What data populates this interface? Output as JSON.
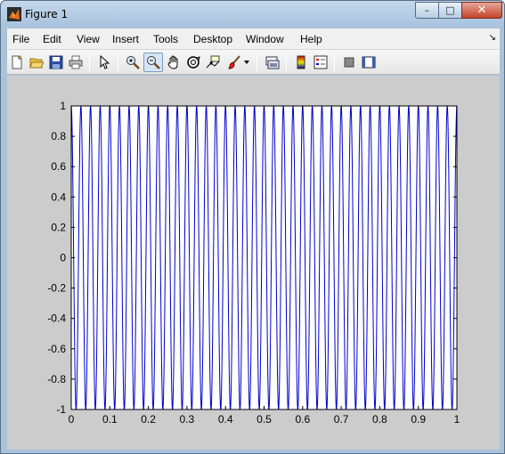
{
  "window": {
    "title": "Figure 1",
    "minimize_symbol": "–",
    "maximize_symbol": "□",
    "close_symbol": "✕"
  },
  "menubar": {
    "items": [
      "File",
      "Edit",
      "View",
      "Insert",
      "Tools",
      "Desktop",
      "Window",
      "Help"
    ],
    "overflow_symbol": "↘"
  },
  "toolbar": {
    "buttons": [
      {
        "name": "new-figure-icon"
      },
      {
        "name": "open-file-icon"
      },
      {
        "name": "save-icon"
      },
      {
        "name": "print-icon"
      },
      {
        "name": "edit-plot-arrow-icon"
      },
      {
        "name": "zoom-in-icon"
      },
      {
        "name": "zoom-out-icon",
        "active": true
      },
      {
        "name": "pan-hand-icon"
      },
      {
        "name": "rotate-3d-icon"
      },
      {
        "name": "data-cursor-icon"
      },
      {
        "name": "brush-icon"
      },
      {
        "name": "brush-dropdown-icon"
      },
      {
        "name": "link-plot-icon"
      },
      {
        "name": "insert-colorbar-icon"
      },
      {
        "name": "insert-legend-icon"
      },
      {
        "name": "hide-plot-tools-icon"
      },
      {
        "name": "show-plot-tools-icon"
      }
    ]
  },
  "chart_data": {
    "type": "line",
    "xlim": [
      0,
      1
    ],
    "ylim": [
      -1,
      1
    ],
    "xticks": [
      "0",
      "0.1",
      "0.2",
      "0.3",
      "0.4",
      "0.5",
      "0.6",
      "0.7",
      "0.8",
      "0.9",
      "1"
    ],
    "yticks": [
      "1",
      "0.8",
      "0.6",
      "0.4",
      "0.2",
      "0",
      "-0.2",
      "-0.4",
      "-0.6",
      "-0.8",
      "-1"
    ],
    "series": [
      {
        "function": "cos(2*pi*f*x)",
        "frequency": 40,
        "color": "#0000cc",
        "x_start": 0,
        "x_end": 1,
        "samples": 2000
      }
    ],
    "grid": false,
    "axes_color": "#000000",
    "plot_background": "#ffffff"
  },
  "colors": {
    "figure_background": "#cccccc",
    "line": "#0000cc"
  }
}
